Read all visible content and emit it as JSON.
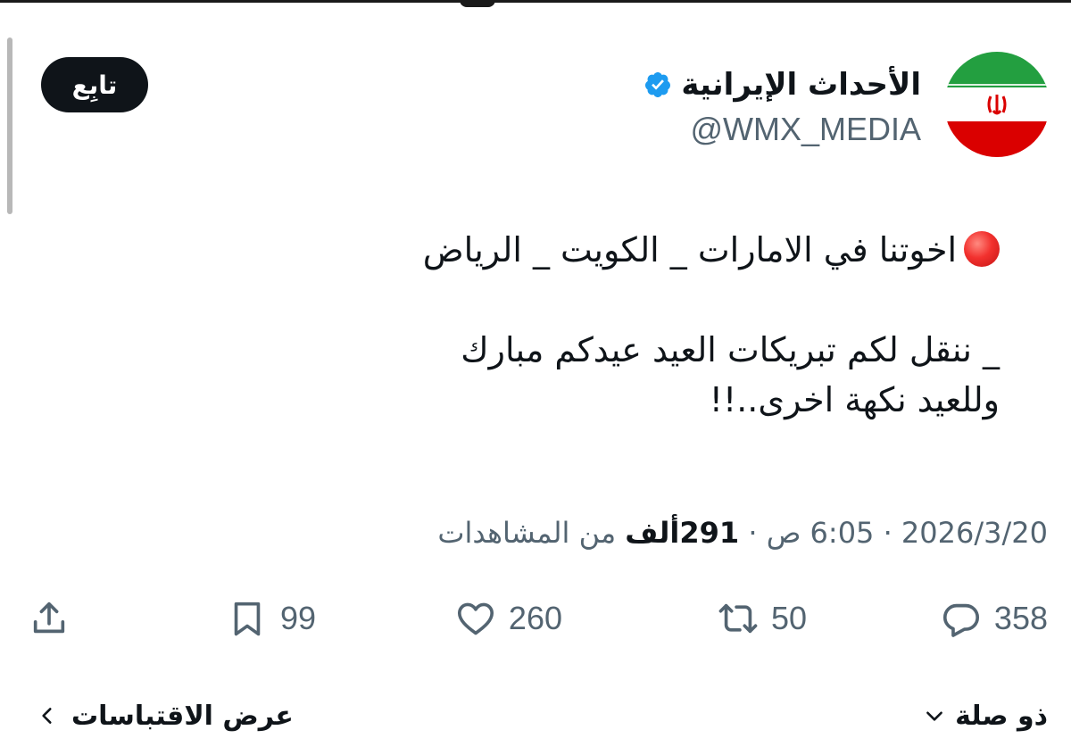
{
  "tweet": {
    "author": {
      "display_name": "الأحداث الإيرانية",
      "handle": "@WMX_MEDIA",
      "verified": true,
      "avatar_icon": "iran-flag-icon"
    },
    "follow_label": "تابِع",
    "text_lines": [
      "اخوتنا في الامارات _ الكويت _ الرياض",
      "",
      "_ ننقل لكم تبريكات العيد عيدكم مبارك",
      "وللعيد نكهة اخرى..!!"
    ],
    "lead_emoji": "red-circle-icon",
    "meta": {
      "date": "2026/3/20",
      "separator": "·",
      "time": "6:05 ص",
      "views_count": "291ألف",
      "views_label": "من المشاهدات"
    },
    "actions": {
      "replies": "358",
      "retweets": "50",
      "likes": "260",
      "bookmarks": "99"
    },
    "related_label": "ذو صلة",
    "quotes_label": "عرض الاقتباسات"
  },
  "colors": {
    "text_primary": "#0f1419",
    "text_secondary": "#536471",
    "verified_blue": "#1d9bf0",
    "follow_button_bg": "#0f1419",
    "flag_green": "#239f40",
    "flag_red": "#da0000"
  }
}
